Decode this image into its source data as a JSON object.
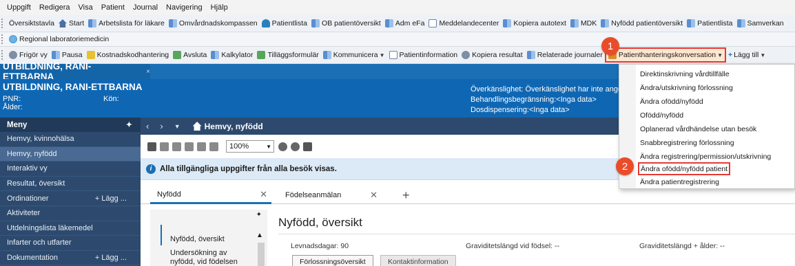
{
  "menubar": {
    "items": [
      "Uppgift",
      "Redigera",
      "Visa",
      "Patient",
      "Journal",
      "Navigering",
      "Hjälp"
    ]
  },
  "toolbar1": {
    "items": [
      {
        "label": "Översiktstavla",
        "icon": "grid-icon"
      },
      {
        "label": "Start",
        "icon": "home-icon"
      },
      {
        "label": "Arbetslista för läkare",
        "icon": "grid-icon"
      },
      {
        "label": "Omvårdnadskompassen",
        "icon": "grid-icon"
      },
      {
        "label": "Patientlista",
        "icon": "person-icon"
      },
      {
        "label": "OB patientöversikt",
        "icon": "grid-icon"
      },
      {
        "label": "Adm eFa",
        "icon": "grid-icon"
      },
      {
        "label": "Meddelandecenter",
        "icon": "mail-icon"
      },
      {
        "label": "Kopiera autotext",
        "icon": "grid-icon"
      },
      {
        "label": "MDK",
        "icon": "grid-icon"
      },
      {
        "label": "Nyfödd patientöversikt",
        "icon": "grid-icon"
      },
      {
        "label": "Patientlista",
        "icon": "grid-icon"
      },
      {
        "label": "Samverkan",
        "icon": "grid-icon"
      }
    ]
  },
  "toolbar2": {
    "item": "Regional laboratoriemedicin"
  },
  "toolbar3": {
    "items": [
      {
        "label": "Frigör vy",
        "icon": "unlock-icon"
      },
      {
        "label": "Pausa",
        "icon": "pause-icon"
      },
      {
        "label": "Kostnadskodhantering",
        "icon": "money-icon"
      },
      {
        "label": "Avsluta",
        "icon": "exit-icon"
      },
      {
        "label": "Kalkylator",
        "icon": "calculator-icon"
      },
      {
        "label": "Tilläggsformulär",
        "icon": "form-icon"
      },
      {
        "label": "Kommunicera",
        "icon": "communicate-icon",
        "dropdown": true
      },
      {
        "label": "Patientinformation",
        "icon": "info-doc-icon"
      },
      {
        "label": "Kopiera resultat",
        "icon": "copy-icon"
      },
      {
        "label": "Relaterade journaler",
        "icon": "records-icon"
      }
    ],
    "highlighted": "Patienthanteringskonversation",
    "add_label": "Lägg till",
    "add_icon": "plus-icon"
  },
  "badges": {
    "one": "1",
    "two": "2"
  },
  "patient_tab": {
    "name": "UTBILDNING, RANI-ETTBARNA",
    "close": "×"
  },
  "banner": {
    "name": "UTBILDNING, RANI-ETTBARNA",
    "pnr": "PNR:",
    "kon": "Kön:",
    "alder": "Ålder:",
    "overkanslighet": "Överkänslighet: Överkänslighet har inte angetts",
    "behandling": "Behandlingsbegränsning:<Inga data>",
    "dos": "Dosdispensering:<Inga data>"
  },
  "sidebar": {
    "title": "Meny",
    "items": [
      {
        "label": "Hemvy, kvinnohälsa"
      },
      {
        "label": "Hemvy, nyfödd"
      },
      {
        "label": "Interaktiv vy"
      },
      {
        "label": "Resultat, översikt"
      },
      {
        "label": "Ordinationer",
        "add": "+ Lägg ..."
      },
      {
        "label": "Aktiviteter"
      },
      {
        "label": "Utdelningslista läkemedel"
      },
      {
        "label": "Infarter och utfarter"
      },
      {
        "label": "Dokumentation",
        "add": "+ Lägg ..."
      }
    ]
  },
  "nav": {
    "title": "Hemvy, nyfödd"
  },
  "content_toolbar": {
    "zoom": "100%"
  },
  "info": {
    "text": "Alla tillgängliga uppgifter från alla besök visas."
  },
  "content_tabs": [
    {
      "label": "Nyfödd"
    },
    {
      "label": "Födelseanmälan"
    }
  ],
  "left_panel": {
    "items": [
      "Nyfödd, översikt",
      "Undersökning av",
      "nyfödd, vid födelsen"
    ]
  },
  "main": {
    "title": "Nyfödd, översikt",
    "levnadsdagar": "Levnadsdagar: 90",
    "gravid_fodsel": "Graviditetslängd vid födsel: --",
    "gravid_alder": "Graviditetslängd + ålder: --",
    "btn1": "Förlossningsöversikt",
    "btn2": "Kontaktinformation"
  },
  "dropdown": {
    "items": [
      "Direktinskrivning vårdtillfälle",
      "Ändra/utskrivning förlossning",
      "Ändra ofödd/nyfödd",
      "Ofödd/nyfödd",
      "Oplanerad vårdhändelse utan besök",
      "Snabbregistrering förlossning",
      "Ändra registrering/permission/utskrivning",
      "Ändra ofödd/nyfödd patient",
      "Ändra patientregistrering"
    ]
  },
  "colors": {
    "accent": "#1a6fb5",
    "sidebar": "#2d4a6e",
    "highlight": "#e53935",
    "badge": "#ea4c2a"
  }
}
